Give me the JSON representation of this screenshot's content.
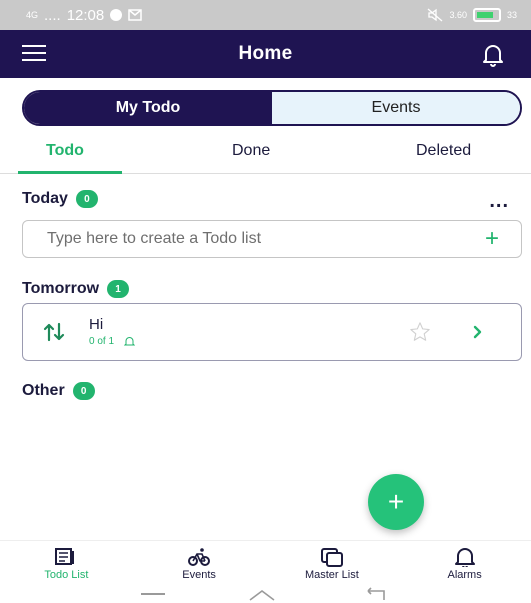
{
  "status_bar": {
    "network": "4G",
    "signal": "....",
    "time": "12:08",
    "speed": "3.60",
    "battery": "33"
  },
  "appbar": {
    "title": "Home"
  },
  "segment": {
    "my_todo": "My Todo",
    "events": "Events"
  },
  "tabs": {
    "todo": "Todo",
    "done": "Done",
    "deleted": "Deleted"
  },
  "sections": {
    "today": {
      "label": "Today",
      "count": "0",
      "more": "..."
    },
    "tomorrow": {
      "label": "Tomorrow",
      "count": "1"
    },
    "other": {
      "label": "Other",
      "count": "0"
    }
  },
  "create_input": {
    "placeholder": "Type here to create a Todo list",
    "value": ""
  },
  "todo_item": {
    "title": "Hi",
    "progress": "0 of 1"
  },
  "fab": {
    "label": "+"
  },
  "bottom_nav": {
    "todo_list": "Todo List",
    "events": "Events",
    "master_list": "Master List",
    "alarms": "Alarms"
  },
  "colors": {
    "primary": "#1f1452",
    "accent": "#22b46e",
    "statusbar": "#c9c9c9"
  },
  "icons": [
    "menu-icon",
    "bell-icon",
    "sort-icon",
    "star-icon",
    "chevron-right-icon",
    "plus-icon",
    "list-icon",
    "bicycle-icon",
    "master-list-icon",
    "alarm-icon"
  ]
}
